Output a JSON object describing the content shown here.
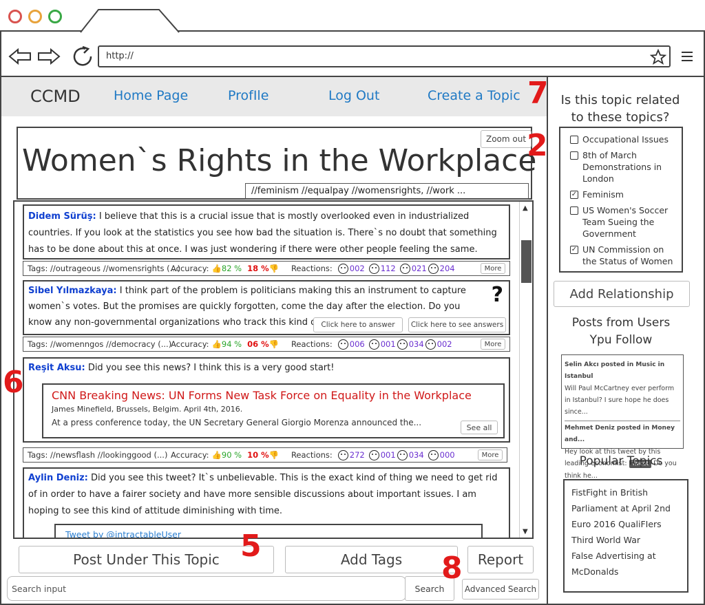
{
  "browser": {
    "url": "http://"
  },
  "nav": {
    "brand": "CCMD",
    "home": "Home Page",
    "profile": "ProfIle",
    "logout": "Log Out",
    "create": "Create a Topic"
  },
  "topic": {
    "title": "Women`s Rights in the Workplace",
    "zoom": "Zoom out",
    "tags": "//feminism //equalpay //womensrights, //work ..."
  },
  "posts": [
    {
      "author": "Didem Sürüş:",
      "text": "I believe that this is a crucial issue that is mostly overlooked even in industrialized countries. If you look at the statistics you see how bad the situation is. There`s no doubt that something has to be done about this at once. I was just wondering if there were other people feeling the same.",
      "tags": "Tags: //outrageous //womensrights (...)",
      "accuracy_label": "Accuracy:",
      "acc_up": "82 %",
      "acc_down": "18 %",
      "reactions_label": "Reactions:",
      "r1": "002",
      "r2": "112",
      "r3": "021",
      "r4": "204",
      "more": "More"
    },
    {
      "author": "Sibel Yılmazkaya:",
      "text": "I think part of the problem is politicians making this an instrument to capture women`s votes. But the promises are quickly forgotten, come the day after the election. Do you know any non-governmental organizations who track this kind of stuff?",
      "answer_btn": "Click here to answer",
      "see_btn": "Click here to see answers",
      "tags": "Tags: //womenngos //democracy   (...)",
      "accuracy_label": "Accuracy:",
      "acc_up": "94 %",
      "acc_down": "06 %",
      "reactions_label": "Reactions:",
      "r1": "006",
      "r2": "001",
      "r3": "034",
      "r4": "002",
      "more": "More"
    },
    {
      "author": "Reşit Aksu:",
      "text": "Did you see this news? I think this is a very good start!",
      "news_title": "CNN Breaking News: UN Forms New Task Force on Equality in the Workplace",
      "news_byline": "James Minefield, Brussels, Belgim. April 4th, 2016.",
      "news_body": "At a press conference today, the UN Secretary General Giorgio Morenza announced the...",
      "see_all": "See all",
      "tags": "Tags: //newsflash //lookinggood (...)",
      "accuracy_label": "Accuracy:",
      "acc_up": "90 %",
      "acc_down": "10 %",
      "reactions_label": "Reactions:",
      "r1": "272",
      "r2": "001",
      "r3": "034",
      "r4": "000",
      "more": "More"
    },
    {
      "author": "Aylin Deniz:",
      "text": "Did you see this tweet? It`s unbelievable. This is the exact kind of thing we need to get rid of in order to have a fairer society and have more sensible discussions about important issues. I am hoping to see this kind of attitude diminishing with time.",
      "tweet": "Tweet by @intractableUser"
    }
  ],
  "actions": {
    "post": "Post Under This Topic",
    "add_tags": "Add Tags",
    "report": "Report",
    "search_placeholder": "Search input",
    "search": "Search",
    "advanced": "Advanced Search"
  },
  "sidebar": {
    "question": "Is this topic related to these topics?",
    "related": [
      {
        "label": "Occupational Issues",
        "checked": false
      },
      {
        "label": "8th of March Demonstrations in London",
        "checked": false
      },
      {
        "label": "Feminism",
        "checked": true
      },
      {
        "label": "US Women's Soccer Team Sueing the Government",
        "checked": false
      },
      {
        "label": "UN Commission on the Status of Women",
        "checked": true
      }
    ],
    "add_relationship": "Add Relationship",
    "follow_title": "Posts from Users Ypu Follow",
    "follow_posts": [
      {
        "head": "Selin Akcı posted in Music in Istanbul",
        "body": "Will Paul McCartney ever perform in Istanbul? I sure hope he does since..."
      },
      {
        "head": "Mehmet Deniz posted in Money and...",
        "body_a": "Hey look at this tweet by this leading economist:",
        "tweet": "Tweet",
        "body_b": "Do you think he..."
      }
    ],
    "popular_title": "Popular Topics",
    "popular": [
      "FistFight in British Parliament at April 2nd",
      "Euro 2016 QualiFIers",
      "Third World War",
      "False Advertising at McDonalds"
    ]
  },
  "annotations": {
    "a7": "7",
    "a2": "2",
    "a6": "6",
    "a5": "5",
    "a8": "8"
  }
}
